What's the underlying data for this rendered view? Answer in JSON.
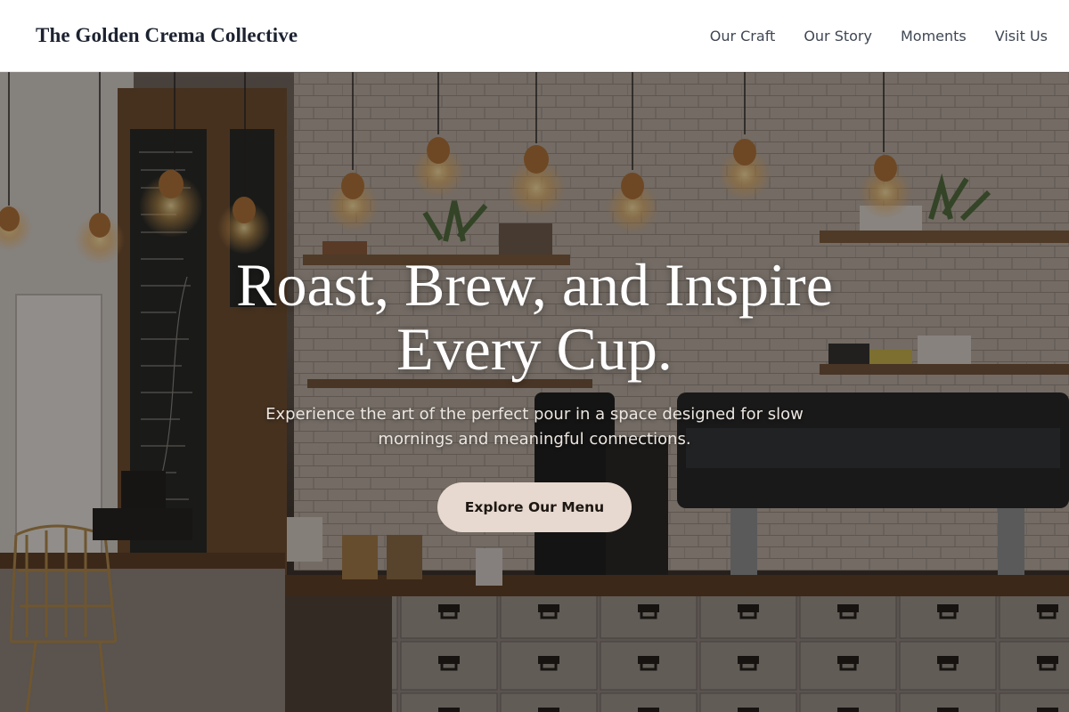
{
  "brand": {
    "name": "The Golden Crema Collective"
  },
  "nav": {
    "items": [
      {
        "label": "Our Craft"
      },
      {
        "label": "Our Story"
      },
      {
        "label": "Moments"
      },
      {
        "label": "Visit Us"
      }
    ]
  },
  "hero": {
    "title": "Roast, Brew, and Inspire Every Cup.",
    "subtitle": "Experience the art of the perfect pour in a space designed for slow mornings and meaningful connections.",
    "cta_label": "Explore Our Menu",
    "background": "cafe-interior-photo"
  },
  "colors": {
    "header_bg": "#ffffff",
    "brand_text": "#1c2230",
    "nav_text": "#3f4753",
    "hero_text": "#ffffff",
    "cta_bg": "#e7d9cf",
    "cta_text": "#1d1712"
  }
}
